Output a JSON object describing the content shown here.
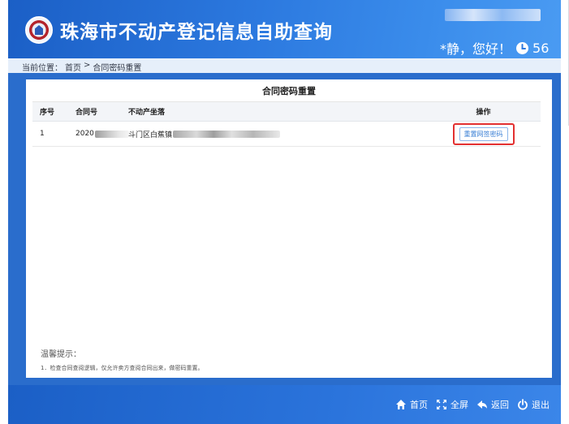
{
  "header": {
    "title": "珠海市不动产登记信息自助查询",
    "greeting": "*静，您好！",
    "countdown": "56"
  },
  "breadcrumb": {
    "label": "当前位置：",
    "items": [
      "首页",
      ">",
      "合同密码重置"
    ]
  },
  "main": {
    "title": "合同密码重置",
    "columns": {
      "no": "序号",
      "contract": "合同号",
      "address": "不动产坐落",
      "operation": "操作"
    },
    "rows": [
      {
        "no": "1",
        "contract_prefix": "2020",
        "address_prefix": "斗门区白蕉镇",
        "action_label": "重置网签密码"
      }
    ],
    "tips": {
      "title": "温馨提示：",
      "line1": "1．检查合同查阅逻辑，仅允许卖方查阅合同出来，做密码重置。"
    }
  },
  "footer": {
    "home": "首页",
    "fullscreen": "全屏",
    "back": "返回",
    "exit": "退出"
  },
  "colors": {
    "header_bg": "#2a6dcc",
    "highlight_border": "#e33030",
    "link_blue": "#3a7fd5"
  }
}
